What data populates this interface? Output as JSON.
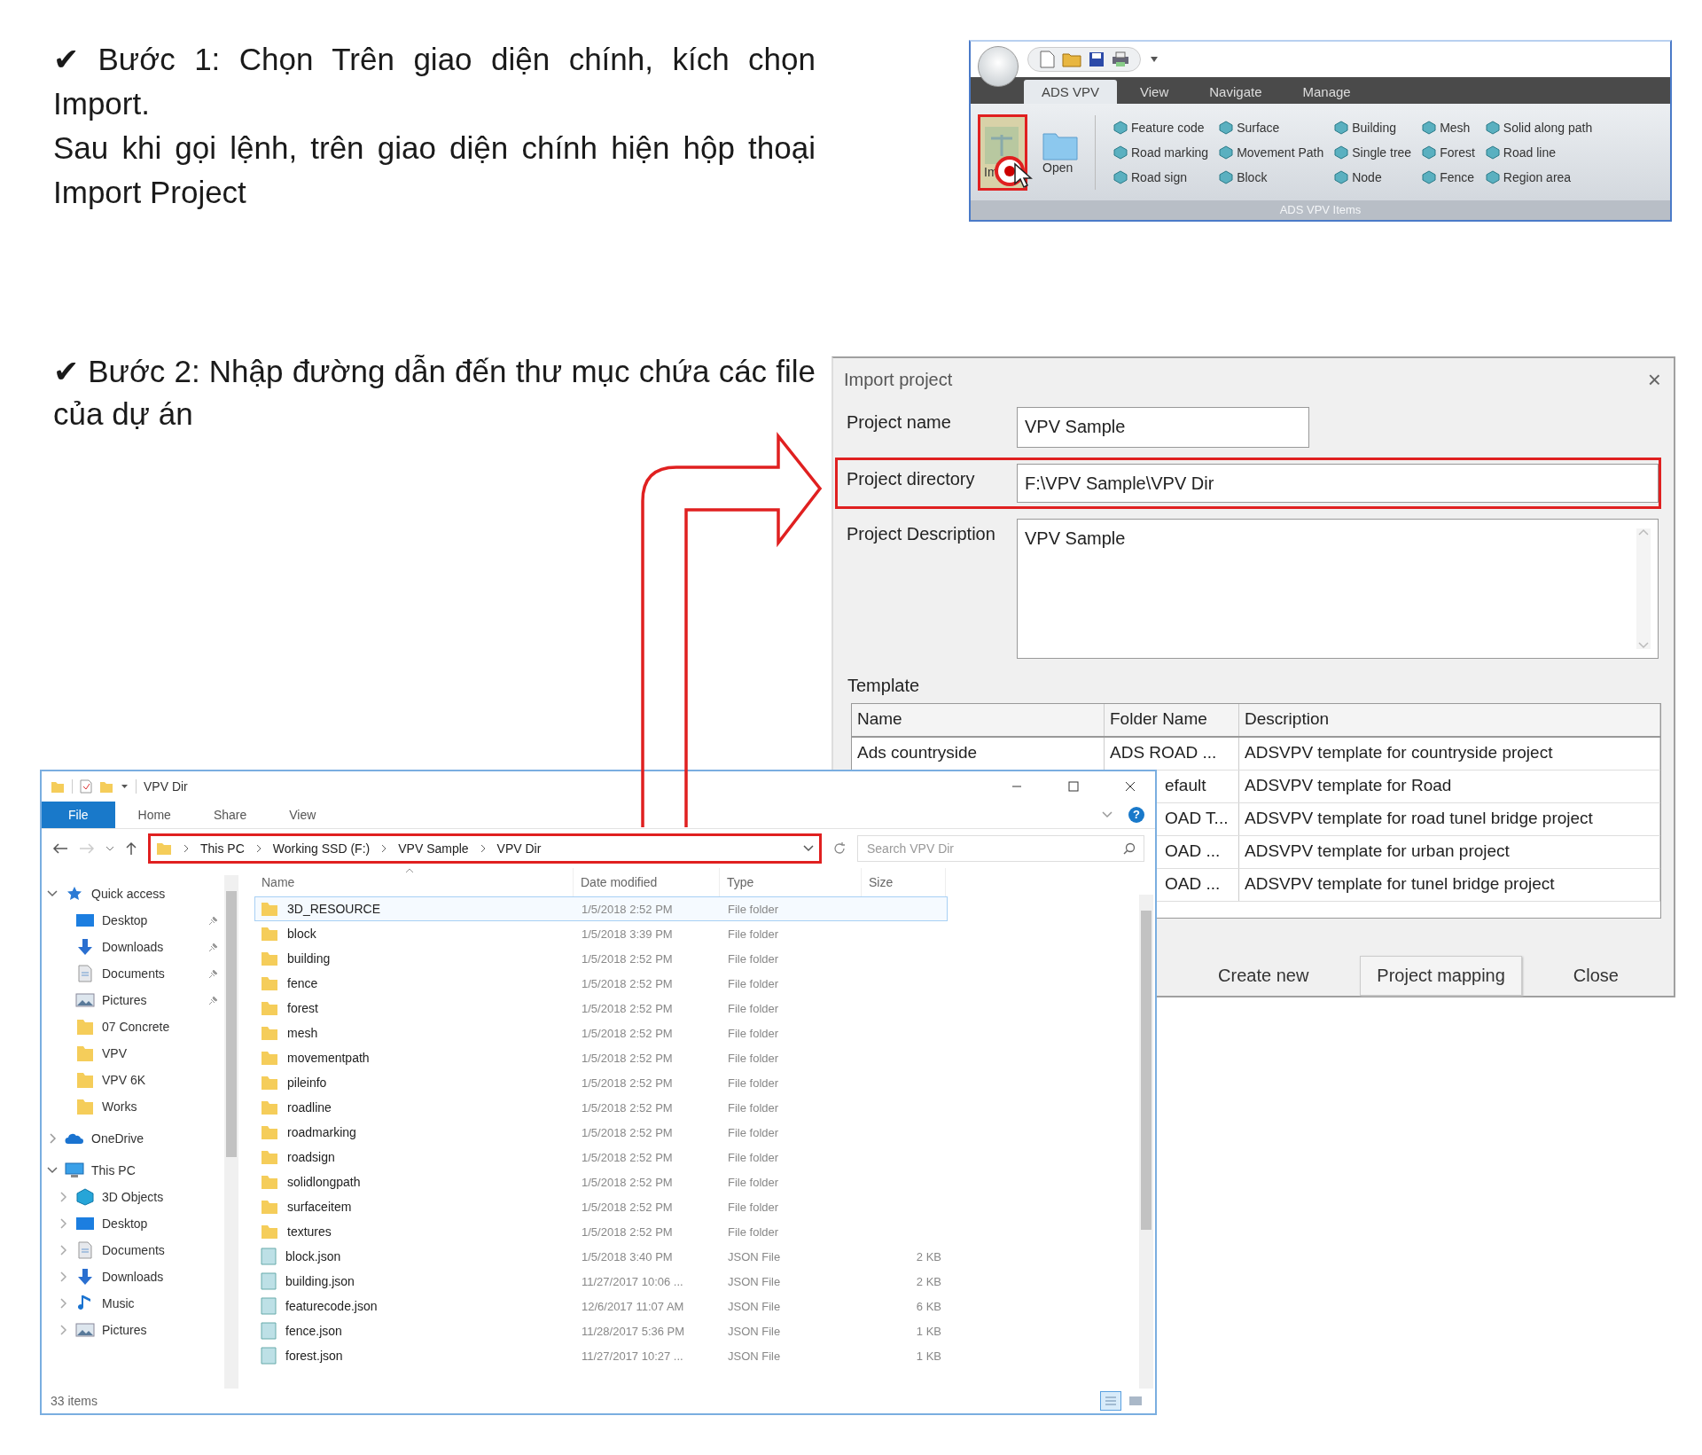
{
  "step1": {
    "text": "✔ Bước 1: Chọn Trên giao diện chính, kích chọn Import.",
    "note": "Sau khi gọi lệnh, trên giao diện chính hiện hộp thoại Import Project"
  },
  "ribbon": {
    "tabs": [
      {
        "label": "ADS VPV",
        "selected": true
      },
      {
        "label": "View",
        "selected": false
      },
      {
        "label": "Navigate",
        "selected": false
      },
      {
        "label": "Manage",
        "selected": false
      }
    ],
    "large_buttons": [
      {
        "label": "Im",
        "kind": "import",
        "highlighted": true
      },
      {
        "label": "Open",
        "kind": "open",
        "highlighted": false
      }
    ],
    "items": [
      "Feature code",
      "Road marking",
      "Road sign",
      "Surface",
      "Movement Path",
      "Block",
      "Building",
      "Single tree",
      "Node",
      "Mesh",
      "Forest",
      "Fence",
      "Solid along path",
      "Road line",
      "Region area"
    ],
    "group_label": "ADS VPV Items"
  },
  "step2": {
    "text": "✔ Bước 2: Nhập đường dẫn đến thư mục chứa các file của dự án"
  },
  "dialog": {
    "title": "Import project",
    "close": "×",
    "fields": [
      {
        "label": "Project name",
        "value": "VPV Sample",
        "kind": "short",
        "highlighted": false
      },
      {
        "label": "Project directory",
        "value": "F:\\VPV Sample\\VPV Dir",
        "kind": "line",
        "highlighted": true
      },
      {
        "label": "Project Description",
        "value": "VPV Sample",
        "kind": "multiline",
        "highlighted": false
      }
    ],
    "template_label": "Template",
    "columns": [
      "Name",
      "Folder Name",
      "Description"
    ],
    "rows": [
      {
        "name": "Ads countryside",
        "folder": "ADS ROAD ...",
        "description": "ADSVPV template for countryside project"
      },
      {
        "folder": "efault",
        "description": "ADSVPV template for Road"
      },
      {
        "folder": "OAD T...",
        "description": "ADSVPV template for road tunel bridge project"
      },
      {
        "folder": "OAD ...",
        "description": "ADSVPV template for urban project"
      },
      {
        "folder": "OAD ...",
        "description": "ADSVPV template for tunel bridge project"
      }
    ],
    "buttons": [
      {
        "label": "Create new",
        "kind": "flat"
      },
      {
        "label": "Project mapping",
        "kind": "raised"
      },
      {
        "label": "Close",
        "kind": "flat"
      }
    ]
  },
  "explorer": {
    "title": "VPV Dir",
    "tabs": [
      {
        "label": "File",
        "selected": true
      },
      {
        "label": "Home",
        "selected": false
      },
      {
        "label": "Share",
        "selected": false
      },
      {
        "label": "View",
        "selected": false
      }
    ],
    "help": "?",
    "address": {
      "highlighted": true,
      "segments": [
        "This PC",
        "Working SSD (F:)",
        "VPV Sample",
        "VPV Dir"
      ]
    },
    "search": {
      "placeholder": "Search VPV Dir"
    },
    "nav": [
      {
        "label": "Quick access",
        "kind": "star",
        "expanded": true,
        "children": [
          {
            "label": "Desktop",
            "kind": "desktop",
            "pinned": true
          },
          {
            "label": "Downloads",
            "kind": "download",
            "pinned": true
          },
          {
            "label": "Documents",
            "kind": "document",
            "pinned": true
          },
          {
            "label": "Pictures",
            "kind": "picture",
            "pinned": true
          },
          {
            "label": "07 Concrete",
            "kind": "folder",
            "pinned": false
          },
          {
            "label": "VPV",
            "kind": "folder",
            "pinned": false
          },
          {
            "label": "VPV 6K",
            "kind": "folder",
            "pinned": false
          },
          {
            "label": "Works",
            "kind": "folder",
            "pinned": false
          }
        ]
      },
      {
        "label": "OneDrive",
        "kind": "cloud",
        "expanded": false
      },
      {
        "label": "This PC",
        "kind": "computer",
        "expanded": true,
        "children": [
          {
            "label": "3D Objects",
            "kind": "cube",
            "expanded": false
          },
          {
            "label": "Desktop",
            "kind": "desktop",
            "expanded": false
          },
          {
            "label": "Documents",
            "kind": "document",
            "expanded": false
          },
          {
            "label": "Downloads",
            "kind": "download",
            "expanded": false
          },
          {
            "label": "Music",
            "kind": "music",
            "expanded": false
          },
          {
            "label": "Pictures",
            "kind": "picture",
            "expanded": false
          }
        ]
      }
    ],
    "columns": [
      "Name",
      "Date modified",
      "Type",
      "Size"
    ],
    "files": [
      {
        "name": "3D_RESOURCE",
        "date": "1/5/2018 2:52 PM",
        "type": "File folder",
        "kind": "folder",
        "selected": true
      },
      {
        "name": "block",
        "date": "1/5/2018 3:39 PM",
        "type": "File folder",
        "kind": "folder",
        "selected": false
      },
      {
        "name": "building",
        "date": "1/5/2018 2:52 PM",
        "type": "File folder",
        "kind": "folder",
        "selected": false
      },
      {
        "name": "fence",
        "date": "1/5/2018 2:52 PM",
        "type": "File folder",
        "kind": "folder",
        "selected": false
      },
      {
        "name": "forest",
        "date": "1/5/2018 2:52 PM",
        "type": "File folder",
        "kind": "folder",
        "selected": false
      },
      {
        "name": "mesh",
        "date": "1/5/2018 2:52 PM",
        "type": "File folder",
        "kind": "folder",
        "selected": false
      },
      {
        "name": "movementpath",
        "date": "1/5/2018 2:52 PM",
        "type": "File folder",
        "kind": "folder",
        "selected": false
      },
      {
        "name": "pileinfo",
        "date": "1/5/2018 2:52 PM",
        "type": "File folder",
        "kind": "folder",
        "selected": false
      },
      {
        "name": "roadline",
        "date": "1/5/2018 2:52 PM",
        "type": "File folder",
        "kind": "folder",
        "selected": false
      },
      {
        "name": "roadmarking",
        "date": "1/5/2018 2:52 PM",
        "type": "File folder",
        "kind": "folder",
        "selected": false
      },
      {
        "name": "roadsign",
        "date": "1/5/2018 2:52 PM",
        "type": "File folder",
        "kind": "folder",
        "selected": false
      },
      {
        "name": "solidlongpath",
        "date": "1/5/2018 2:52 PM",
        "type": "File folder",
        "kind": "folder",
        "selected": false
      },
      {
        "name": "surfaceitem",
        "date": "1/5/2018 2:52 PM",
        "type": "File folder",
        "kind": "folder",
        "selected": false
      },
      {
        "name": "textures",
        "date": "1/5/2018 2:52 PM",
        "type": "File folder",
        "kind": "folder",
        "selected": false
      },
      {
        "name": "block.json",
        "date": "1/5/2018 3:40 PM",
        "type": "JSON File",
        "size": "2 KB",
        "kind": "json",
        "selected": false
      },
      {
        "name": "building.json",
        "date": "11/27/2017 10:06 ...",
        "type": "JSON File",
        "size": "2 KB",
        "kind": "json",
        "selected": false
      },
      {
        "name": "featurecode.json",
        "date": "12/6/2017 11:07 AM",
        "type": "JSON File",
        "size": "6 KB",
        "kind": "json",
        "selected": false
      },
      {
        "name": "fence.json",
        "date": "11/28/2017 5:36 PM",
        "type": "JSON File",
        "size": "1 KB",
        "kind": "json",
        "selected": false
      },
      {
        "name": "forest.json",
        "date": "11/27/2017 10:27 ...",
        "type": "JSON File",
        "size": "1 KB",
        "kind": "json",
        "selected": false
      }
    ],
    "status": "33 items",
    "views": [
      {
        "kind": "details",
        "selected": true
      },
      {
        "kind": "preview",
        "selected": false
      }
    ]
  }
}
